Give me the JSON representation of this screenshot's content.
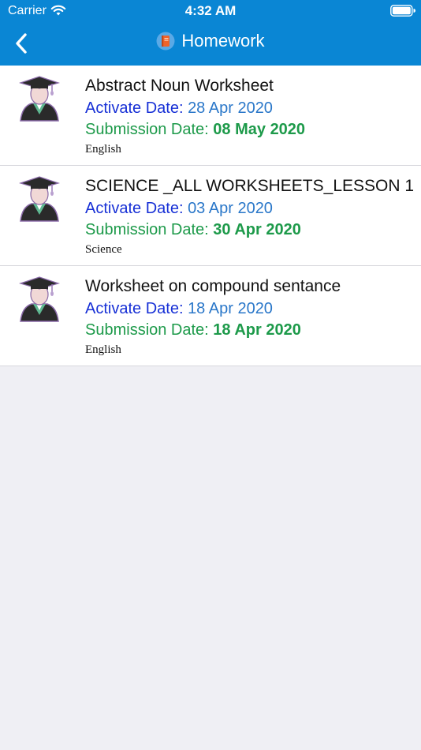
{
  "status_bar": {
    "carrier": "Carrier",
    "time": "4:32 AM"
  },
  "nav": {
    "back_icon": "chevron-left-icon",
    "title_icon": "book-icon",
    "title": "Homework"
  },
  "colors": {
    "header": "#0a86d4",
    "activate_label": "#1730d6",
    "activate_value": "#2a77c9",
    "submission": "#1d9a4a"
  },
  "homework": [
    {
      "title": "Abstract Noun Worksheet",
      "activate_label": "Activate Date: ",
      "activate_date": "28 Apr 2020",
      "submission_label": "Submission Date: ",
      "submission_date": "08 May 2020",
      "subject": "English",
      "icon": "graduate-avatar-icon"
    },
    {
      "title": "SCIENCE _ALL WORKSHEETS_LESSON 1",
      "activate_label": "Activate Date: ",
      "activate_date": "03 Apr 2020",
      "submission_label": "Submission Date: ",
      "submission_date": "30 Apr 2020",
      "subject": "Science",
      "icon": "graduate-avatar-icon"
    },
    {
      "title": "Worksheet on compound sentance",
      "activate_label": "Activate Date: ",
      "activate_date": "18 Apr 2020",
      "submission_label": "Submission Date: ",
      "submission_date": "18 Apr 2020",
      "subject": "English",
      "icon": "graduate-avatar-icon"
    }
  ]
}
